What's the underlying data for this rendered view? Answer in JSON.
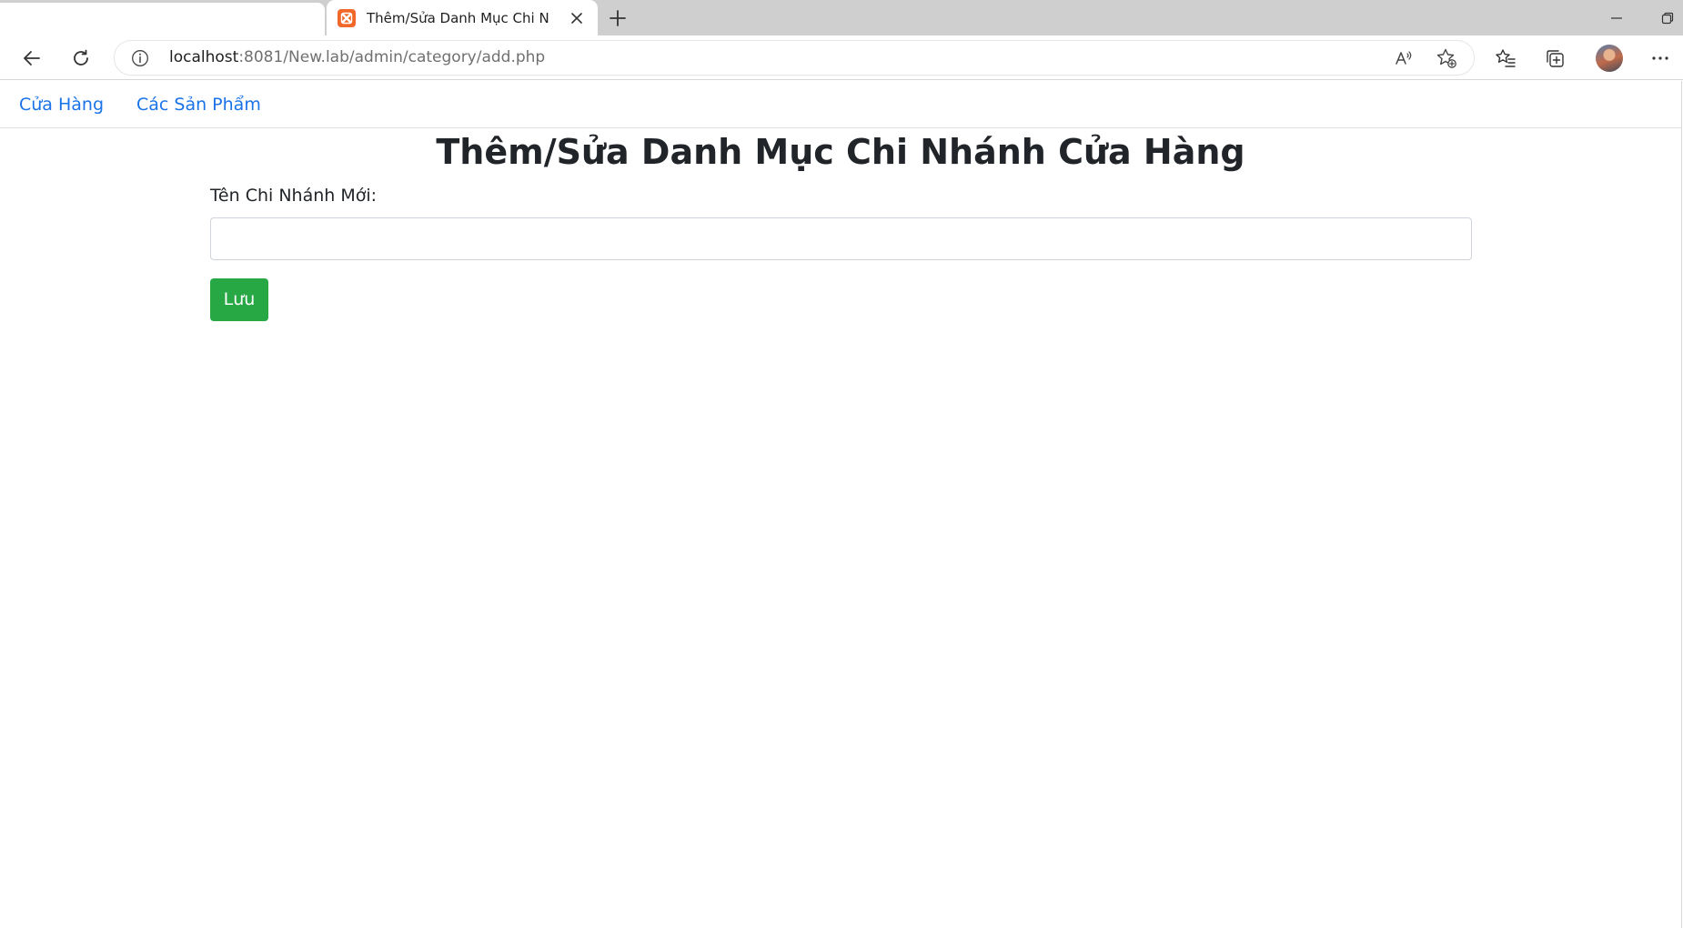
{
  "browser": {
    "tab": {
      "title": "Thêm/Sửa Danh Mục Chi Nhánh",
      "favicon": "xampp-favicon-icon"
    },
    "address_bar": {
      "url_host": "localhost",
      "url_path": ":8081/New.lab/admin/category/add.php"
    },
    "icons": {
      "back": "back-arrow-icon",
      "reload": "reload-icon",
      "info": "site-info-icon",
      "read_aloud": "read-aloud-icon",
      "add_favorite": "add-favorite-icon",
      "favorites": "favorites-icon",
      "collections": "collections-icon",
      "more": "more-icon"
    }
  },
  "site_nav": {
    "links": [
      {
        "label": "Cửa Hàng"
      },
      {
        "label": "Các Sản Phẩm"
      }
    ]
  },
  "form": {
    "title": "Thêm/Sửa Danh Mục Chi Nhánh Cửa Hàng",
    "name_label": "Tên Chi Nhánh Mới:",
    "name_value": "",
    "save_label": "Lưu"
  },
  "colors": {
    "link": "#1a73e8",
    "save_button": "#28a745",
    "favicon": "#f2682a",
    "tabstrip": "#cfcfcf"
  }
}
